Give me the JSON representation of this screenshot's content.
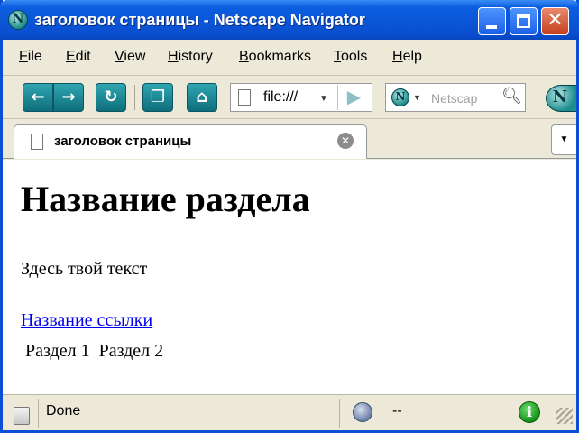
{
  "window": {
    "title": "заголовок страницы - Netscape Navigator",
    "controls": [
      "minimize",
      "maximize",
      "close"
    ]
  },
  "menubar": {
    "items": [
      "File",
      "Edit",
      "View",
      "History",
      "Bookmarks",
      "Tools",
      "Help"
    ]
  },
  "toolbar": {
    "url": "file:///",
    "search_placeholder": "Netscap",
    "icons": [
      "back-icon",
      "forward-icon",
      "reload-icon",
      "tabs-icon",
      "home-icon",
      "go-icon",
      "search-icon"
    ]
  },
  "tabs": [
    {
      "label": "заголовок страницы",
      "active": true
    }
  ],
  "content": {
    "heading": "Название раздела",
    "paragraph": "Здесь твой текст",
    "link": "Название ссылки",
    "sections": [
      "Раздел 1",
      "Раздел 2"
    ]
  },
  "statusbar": {
    "status": "Done",
    "zone": "--"
  },
  "colors": {
    "titlebar": "#0a57d8",
    "chrome": "#ece9d8",
    "link": "#0000ee",
    "nav_button": "#1f8b96"
  }
}
